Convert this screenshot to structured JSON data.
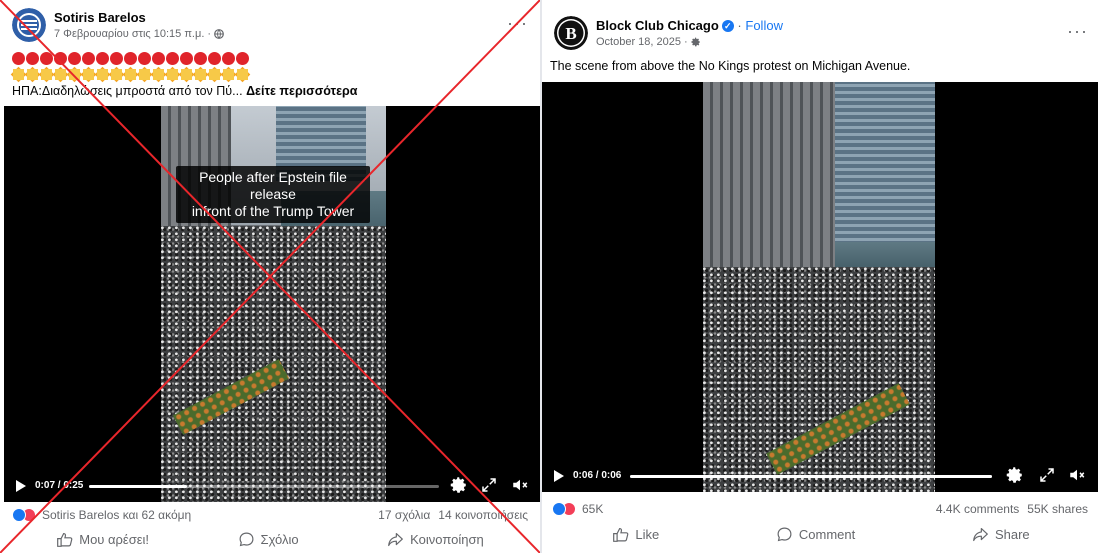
{
  "left_post": {
    "author": "Sotiris Barelos",
    "timestamp": "7 Φεβρουαρίου στις 10:15 π.μ.",
    "audience_icon": "globe-icon",
    "emoji_line_1": "red-circle emoji x16",
    "emoji_line_2": "boom emoji x15",
    "caption_text": "ΗΠΑ:Διαδηλώσεις μπροστά από τον Πύ...",
    "see_more": "Δείτε περισσότερα",
    "video_overlay_line1": "People after Epstein file release",
    "video_overlay_line2": "infront of the Trump Tower",
    "video_time": "0:07 / 0:25",
    "video_progress": 0.28,
    "reactions_text": "Sotiris Barelos και 62 ακόμη",
    "comments": "17 σχόλια",
    "shares": "14 κοινοποιήσεις",
    "action_like": "Μου αρέσει!",
    "action_comment": "Σχόλιο",
    "action_share": "Κοινοποίηση",
    "cross_color": "#e8262b"
  },
  "right_post": {
    "author": "Block Club Chicago",
    "follow": "Follow",
    "timestamp": "October 18, 2025",
    "audience_icon": "gear-icon",
    "avatar_letter": "B",
    "caption_text": "The scene from above the No Kings protest on Michigan Avenue.",
    "video_time": "0:06 / 0:06",
    "video_progress": 1.0,
    "reactions_count": "65K",
    "comments": "4.4K comments",
    "shares": "55K shares",
    "action_like": "Like",
    "action_comment": "Comment",
    "action_share": "Share"
  },
  "colors": {
    "facebook_blue": "#1877f2",
    "love_red": "#f33e58",
    "meta_gray": "#65676b"
  }
}
